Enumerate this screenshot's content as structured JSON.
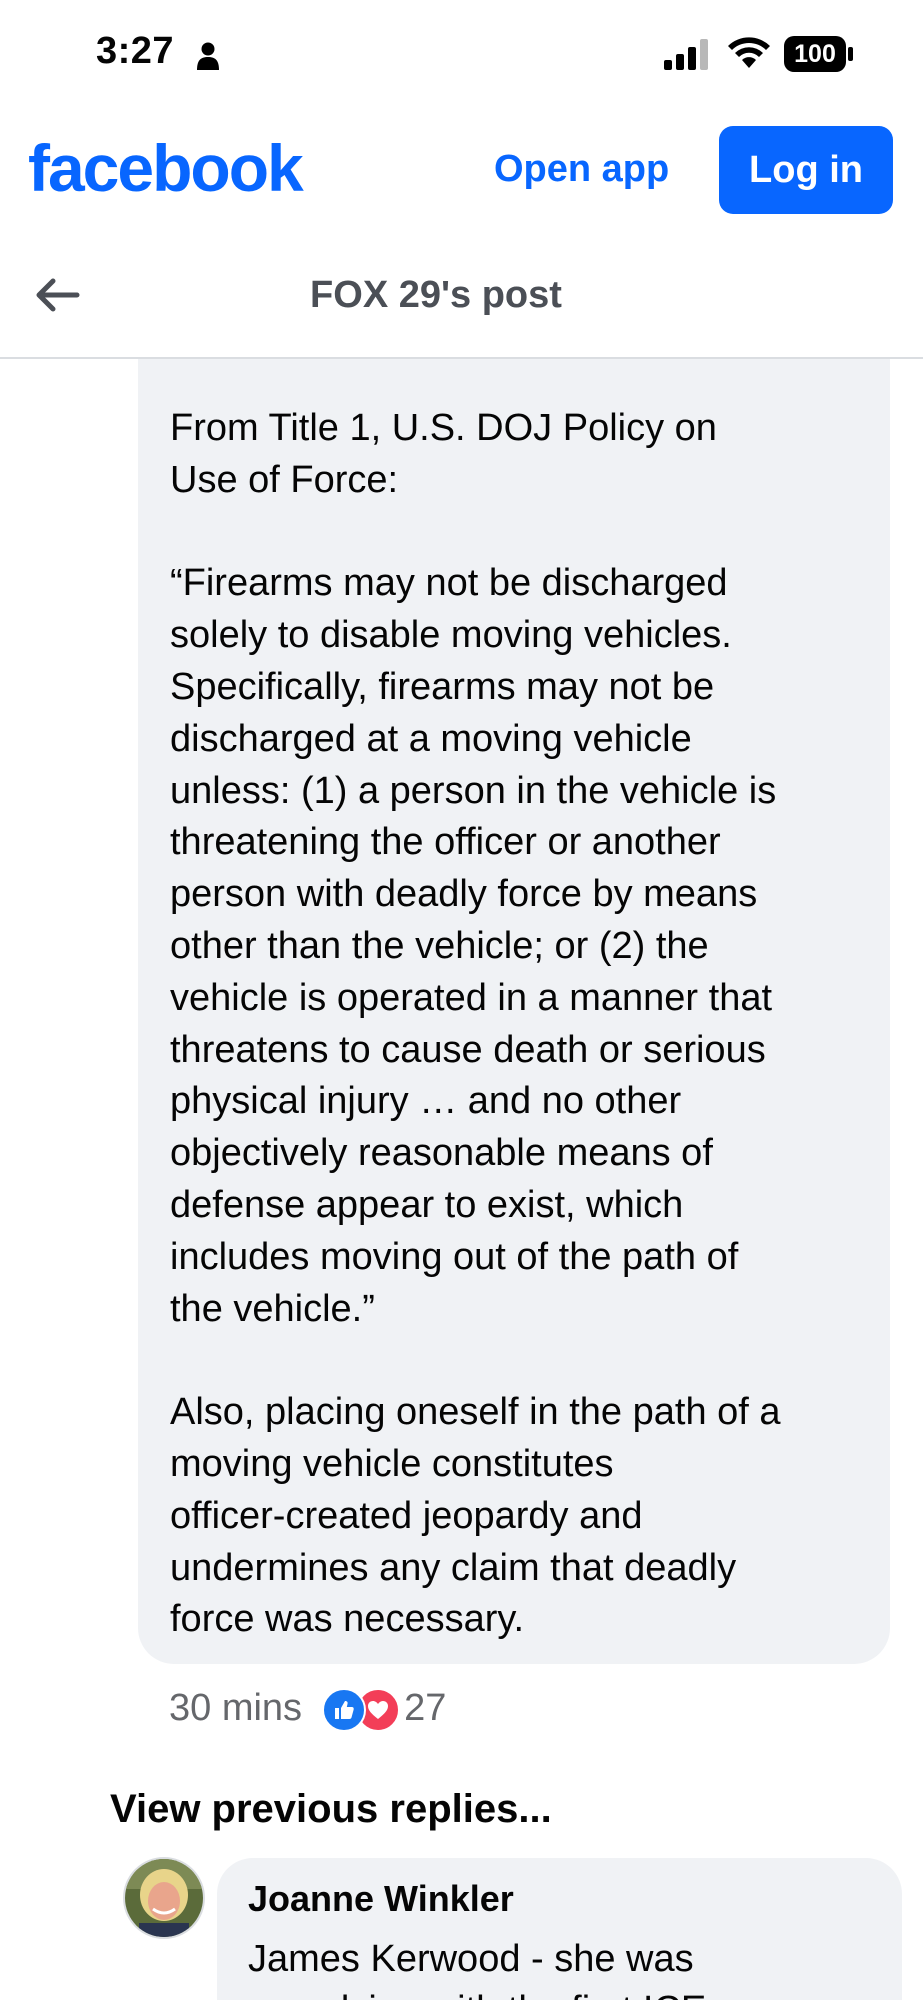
{
  "status_bar": {
    "time": "3:27",
    "battery": "100"
  },
  "header": {
    "logo": "facebook",
    "open_app_label": "Open app",
    "login_label": "Log in"
  },
  "post_nav": {
    "title": "FOX 29's post"
  },
  "comment": {
    "text": "From Title 1, U.S. DOJ Policy on\nUse of Force:\n\n“Firearms may not be discharged\nsolely to disable moving vehicles.\nSpecifically, firearms may not be\ndischarged at a moving vehicle\nunless: (1) a person in the vehicle is\nthreatening the officer or another\nperson with deadly force by means\nother than the vehicle; or (2) the\nvehicle is operated in a manner that\nthreatens to cause death or serious\nphysical injury … and no other\nobjectively reasonable means of\ndefense appear to exist, which\nincludes moving out of the path of\nthe vehicle.”\n\nAlso, placing oneself in the path of a\nmoving vehicle constitutes\nofficer-created jeopardy and\nundermines any claim that deadly\nforce was necessary.",
    "time": "30 mins",
    "reaction_count": "27",
    "reactions": [
      "like-icon",
      "love-icon"
    ]
  },
  "view_previous_label": "View previous replies...",
  "reply": {
    "author": "Joanne Winkler",
    "text": "James Kerwood - she was\ncomplying with the first ICE"
  },
  "colors": {
    "brand_blue": "#0866ff",
    "bubble_bg": "#f0f2f5",
    "secondary_text": "#65676b"
  }
}
